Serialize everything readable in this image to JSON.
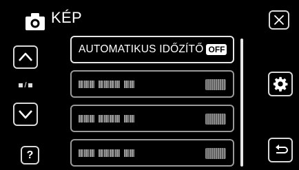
{
  "header": {
    "title": "KÉP",
    "icon": "camera-icon"
  },
  "controls": {
    "close_icon": "close-icon",
    "up_icon": "chevron-up-icon",
    "down_icon": "chevron-down-icon",
    "help_label": "?",
    "settings_icon": "gear-icon",
    "back_icon": "return-icon",
    "page_separator": "/"
  },
  "menu": {
    "items": [
      {
        "label": "AUTOMATIKUS IDŐZÍTŐ",
        "value": "OFF",
        "selected": true
      }
    ]
  },
  "colors": {
    "background": "#000000",
    "border": "#d9d9d9",
    "text": "#ffffff"
  }
}
